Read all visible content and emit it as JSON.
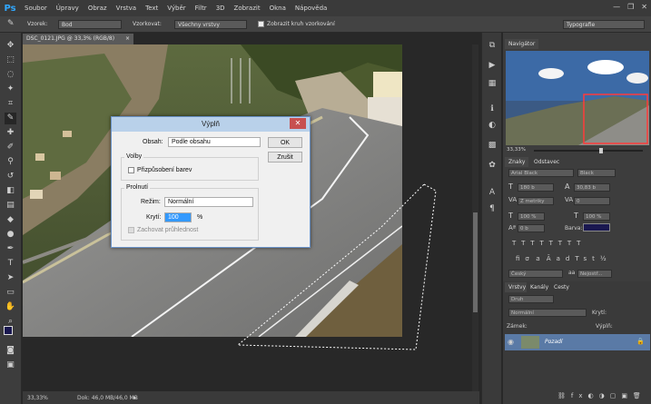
{
  "app": {
    "logo": "Ps",
    "menu": [
      "Soubor",
      "Úpravy",
      "Obraz",
      "Vrstva",
      "Text",
      "Výběr",
      "Filtr",
      "3D",
      "Zobrazit",
      "Okna",
      "Nápověda"
    ],
    "window_controls": [
      "—",
      "❐",
      "✕"
    ]
  },
  "options_bar": {
    "sample_label": "Vzorek:",
    "sample_value": "Bod",
    "sample_source_label": "Vzorkovat:",
    "sample_source_value": "Všechny vrstvy",
    "show_ring_label": "Zobrazit kruh vzorkování",
    "workspace_value": "Typografie"
  },
  "document": {
    "tab_title": "DSC_0121.JPG @ 33,3% (RGB/8)",
    "zoom": "33,33%",
    "doc_size": "Dok: 46,0 MB/46,0 MB"
  },
  "dialog": {
    "title": "Výplň",
    "content_label": "Obsah:",
    "content_value": "Podle obsahu",
    "ok": "OK",
    "cancel": "Zrušit",
    "options_group": "Volby",
    "color_adapt_label": "Přizpůsobení barev",
    "blend_group": "Prolnutí",
    "mode_label": "Režim:",
    "mode_value": "Normální",
    "opacity_label": "Krytí:",
    "opacity_value": "100",
    "opacity_unit": "%",
    "preserve_label": "Zachovat průhlednost"
  },
  "navigator": {
    "tab": "Navigátor",
    "zoom": "33,33%"
  },
  "character": {
    "tab_znaky": "Znaky",
    "tab_odstavec": "Odstavec",
    "font_family": "Arial Black",
    "font_style": "Black",
    "size": "180 b",
    "leading": "30,83 b",
    "kerning": "Z metriky",
    "tracking": "0",
    "vscale": "100 %",
    "hscale": "100 %",
    "baseline": "0 b",
    "color_label": "Barva:",
    "color_hex": "#1a1850",
    "language": "Český",
    "antialias": "Nejostř..."
  },
  "layers": {
    "tab_vrstvy": "Vrstvy",
    "tab_kanaly": "Kanály",
    "tab_cesty": "Cesty",
    "filter_value": "Druh",
    "blend_value": "Normální",
    "opacity_label": "Krytí:",
    "lock_label": "Zámek:",
    "fill_label": "Výplň:",
    "layer_name": "Pozadí"
  }
}
